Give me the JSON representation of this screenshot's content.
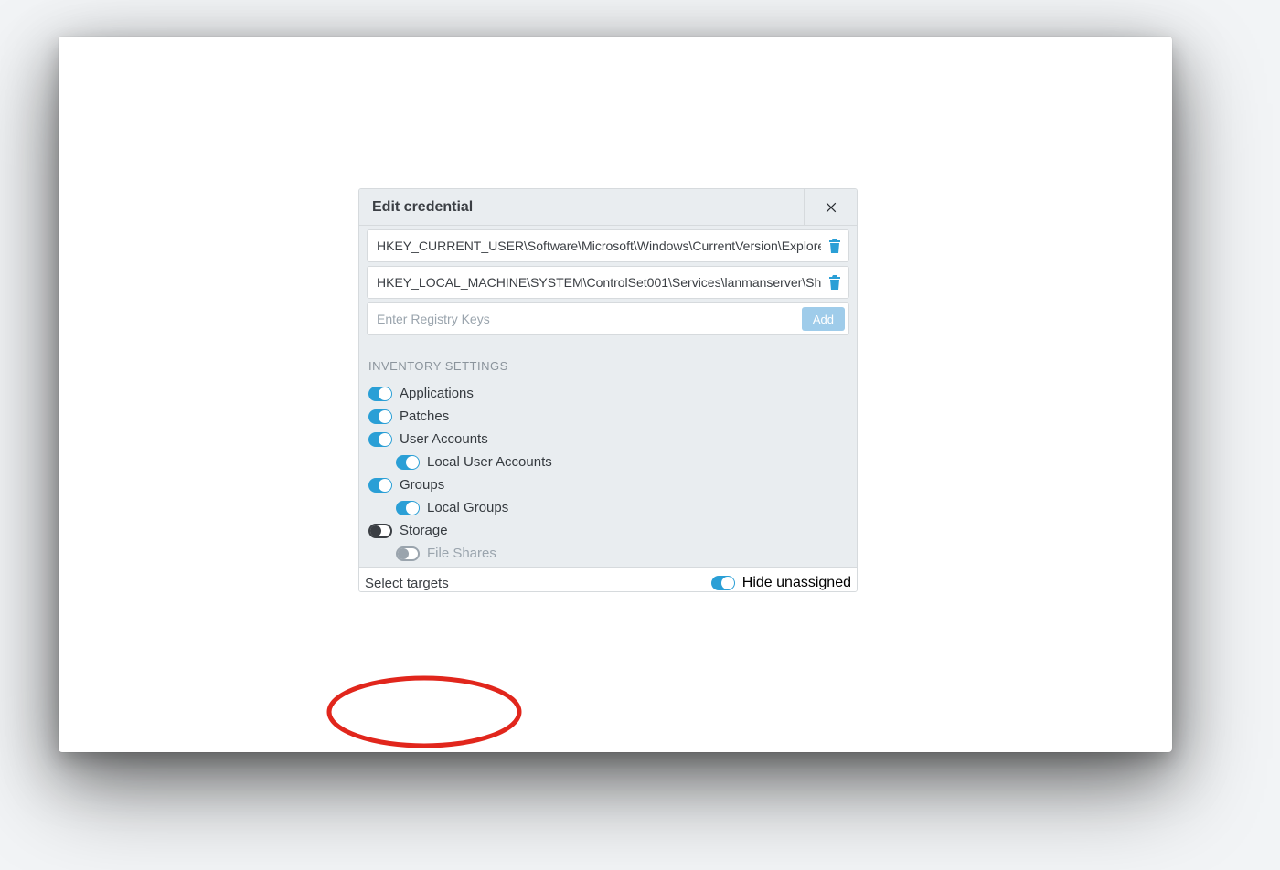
{
  "dialog": {
    "title": "Edit credential",
    "registry_keys": [
      "HKEY_CURRENT_USER\\Software\\Microsoft\\Windows\\CurrentVersion\\Explorer",
      "HKEY_LOCAL_MACHINE\\SYSTEM\\ControlSet001\\Services\\lanmanserver\\Sha"
    ],
    "add_placeholder": "Enter Registry Keys",
    "add_button": "Add",
    "section_label": "INVENTORY SETTINGS",
    "toggles": {
      "applications": {
        "label": "Applications",
        "on": true
      },
      "patches": {
        "label": "Patches",
        "on": true
      },
      "user_accounts": {
        "label": "User Accounts",
        "on": true
      },
      "local_user_accounts": {
        "label": "Local User Accounts",
        "on": true
      },
      "groups": {
        "label": "Groups",
        "on": true
      },
      "local_groups": {
        "label": "Local Groups",
        "on": true
      },
      "storage": {
        "label": "Storage",
        "on": false
      },
      "file_shares": {
        "label": "File Shares",
        "on": false,
        "disabled": true
      }
    }
  },
  "footer": {
    "select_targets": "Select targets",
    "hide_unassigned": {
      "label": "Hide unassigned",
      "on": true
    }
  }
}
